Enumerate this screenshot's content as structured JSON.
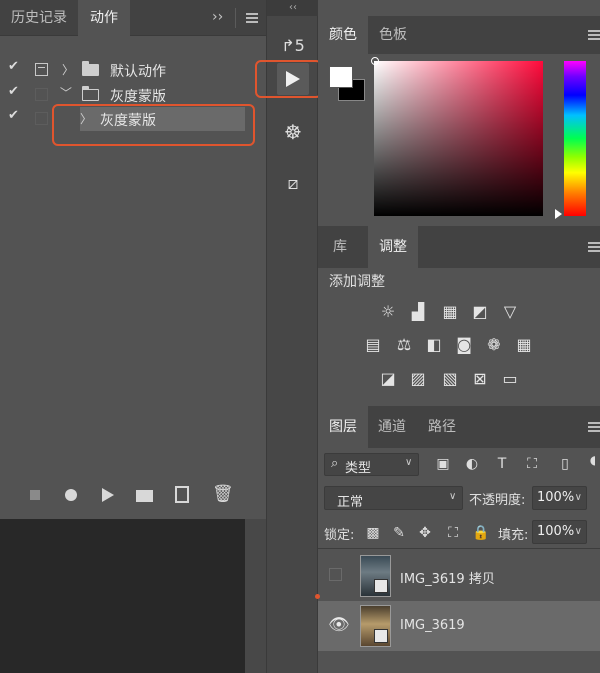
{
  "actions_panel": {
    "tabs": [
      "历史记录",
      "动作"
    ],
    "rows": [
      {
        "label": "默认动作"
      },
      {
        "label": "灰度蒙版"
      },
      {
        "label": "灰度蒙版"
      }
    ]
  },
  "color_panel": {
    "tabs": [
      "颜色",
      "色板"
    ],
    "foreground": "#ffffff",
    "background": "#000000",
    "hue_color": "#ff0a3b"
  },
  "adjustments_panel": {
    "tabs": [
      "库",
      "调整"
    ],
    "title": "添加调整"
  },
  "layers_panel": {
    "tabs": [
      "图层",
      "通道",
      "路径"
    ],
    "filter_label": "类型",
    "blend_mode": "正常",
    "opacity_label": "不透明度:",
    "opacity_value": "100%",
    "lock_label": "锁定:",
    "fill_label": "填充:",
    "fill_value": "100%",
    "layers": [
      {
        "name": "IMG_3619 拷贝",
        "visible": false
      },
      {
        "name": "IMG_3619",
        "visible": true
      }
    ]
  },
  "accent_color": "#e0552e"
}
